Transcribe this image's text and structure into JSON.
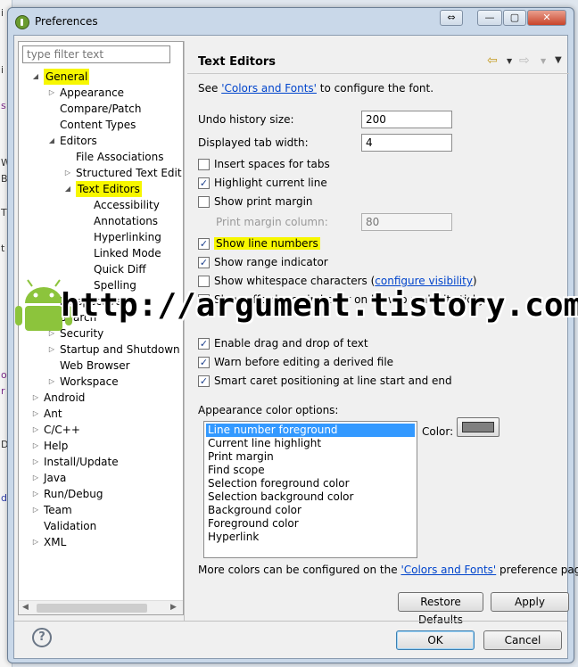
{
  "window": {
    "title": "Preferences",
    "buttons": {
      "restore": "⇔",
      "minimize": "—",
      "maximize": "▢",
      "close": "✕"
    }
  },
  "tree": {
    "filter_placeholder": "type filter text",
    "items": [
      {
        "label": "General",
        "depth": 0,
        "expanded": true,
        "highlighted": true
      },
      {
        "label": "Appearance",
        "depth": 1,
        "expanded": false
      },
      {
        "label": "Compare/Patch",
        "depth": 1
      },
      {
        "label": "Content Types",
        "depth": 1
      },
      {
        "label": "Editors",
        "depth": 1,
        "expanded": true
      },
      {
        "label": "File Associations",
        "depth": 2
      },
      {
        "label": "Structured Text Edit",
        "depth": 2,
        "expanded": false
      },
      {
        "label": "Text Editors",
        "depth": 2,
        "expanded": true,
        "highlighted": true
      },
      {
        "label": "Accessibility",
        "depth": 3
      },
      {
        "label": "Annotations",
        "depth": 3
      },
      {
        "label": "Hyperlinking",
        "depth": 3
      },
      {
        "label": "Linked Mode",
        "depth": 3
      },
      {
        "label": "Quick Diff",
        "depth": 3
      },
      {
        "label": "Spelling",
        "depth": 3
      },
      {
        "label": "Perspectives",
        "depth": 1
      },
      {
        "label": "Search",
        "depth": 1
      },
      {
        "label": "Security",
        "depth": 1,
        "expanded": false
      },
      {
        "label": "Startup and Shutdown",
        "depth": 1,
        "expanded": false
      },
      {
        "label": "Web Browser",
        "depth": 1
      },
      {
        "label": "Workspace",
        "depth": 1,
        "expanded": false
      },
      {
        "label": "Android",
        "depth": 0,
        "expanded": false
      },
      {
        "label": "Ant",
        "depth": 0,
        "expanded": false
      },
      {
        "label": "C/C++",
        "depth": 0,
        "expanded": false
      },
      {
        "label": "Help",
        "depth": 0,
        "expanded": false
      },
      {
        "label": "Install/Update",
        "depth": 0,
        "expanded": false
      },
      {
        "label": "Java",
        "depth": 0,
        "expanded": false
      },
      {
        "label": "Run/Debug",
        "depth": 0,
        "expanded": false
      },
      {
        "label": "Team",
        "depth": 0,
        "expanded": false
      },
      {
        "label": "Validation",
        "depth": 0
      },
      {
        "label": "XML",
        "depth": 0,
        "expanded": false
      }
    ]
  },
  "page": {
    "title": "Text Editors",
    "intro_prefix": "See ",
    "intro_link": "'Colors and Fonts'",
    "intro_suffix": " to configure the font.",
    "undo_label": "Undo history size:",
    "undo_value": "200",
    "tab_label": "Displayed tab width:",
    "tab_value": "4",
    "checkboxes": [
      {
        "label": "Insert spaces for tabs",
        "checked": false
      },
      {
        "label": "Highlight current line",
        "checked": true
      },
      {
        "label": "Show print margin",
        "checked": false
      },
      {
        "label": "Show line numbers",
        "checked": true,
        "highlighted": true
      },
      {
        "label": "Show range indicator",
        "checked": true
      },
      {
        "label": "Show whitespace characters",
        "checked": false,
        "link": "configure visibility"
      },
      {
        "label": "Show affordance in hover on how to make it sticky",
        "checked": true
      },
      {
        "label": "Enable drag and drop of text",
        "checked": true
      },
      {
        "label": "Warn before editing a derived file",
        "checked": true
      },
      {
        "label": "Smart caret positioning at line start and end",
        "checked": true
      }
    ],
    "print_margin_label": "Print margin column:",
    "print_margin_value": "80",
    "color_options_label": "Appearance color options:",
    "color_label": "Color:",
    "color_value": "#808080",
    "color_options": [
      "Line number foreground",
      "Current line highlight",
      "Print margin",
      "Find scope",
      "Selection foreground color",
      "Selection background color",
      "Background color",
      "Foreground color",
      "Hyperlink"
    ],
    "more_colors_prefix": "More colors can be configured on the ",
    "more_colors_link": "'Colors and Fonts'",
    "more_colors_suffix": " preference page.",
    "restore_defaults": "Restore Defaults",
    "apply": "Apply"
  },
  "footer": {
    "help": "?",
    "ok": "OK",
    "cancel": "Cancel"
  },
  "watermark": "http://argument.tistory.com",
  "highlight_color": "#f7f700",
  "selection_color": "#3399ff"
}
